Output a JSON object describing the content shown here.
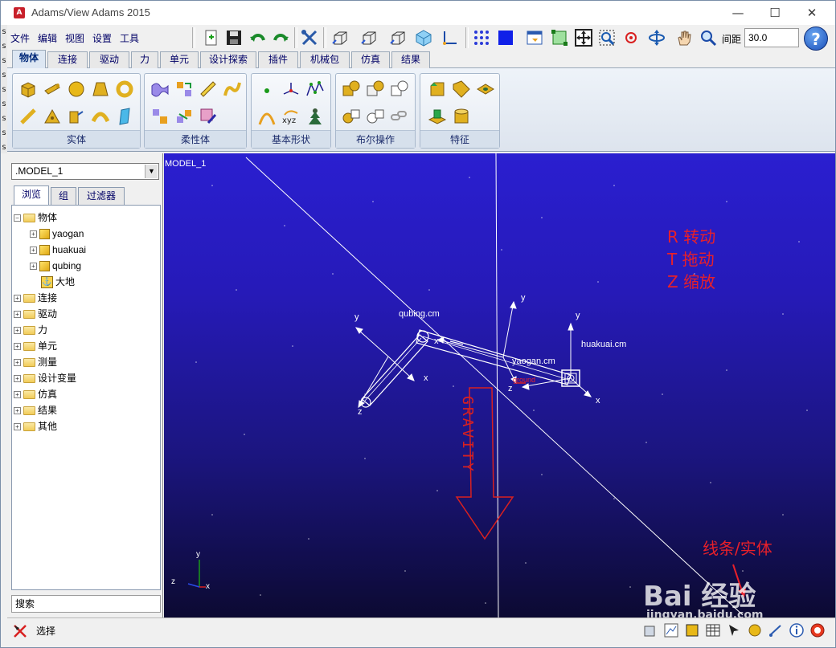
{
  "window": {
    "title": "Adams/View Adams 2015",
    "app_icon_letter": "A",
    "minimize": "—",
    "maximize": "☐",
    "close": "✕"
  },
  "left_edge_letters": [
    "s",
    "s",
    "s",
    "s",
    "s",
    "s",
    "s",
    "s",
    "s"
  ],
  "menu": [
    "文件",
    "编辑",
    "视图",
    "设置",
    "工具"
  ],
  "toolbar": {
    "distance_label": "间距",
    "distance_value": "30.0",
    "help": "?"
  },
  "ribbon_tabs": [
    "物体",
    "连接",
    "驱动",
    "力",
    "单元",
    "设计探索",
    "插件",
    "机械包",
    "仿真",
    "结果"
  ],
  "ribbon_groups": [
    "实体",
    "柔性体",
    "基本形状",
    "布尔操作",
    "特征"
  ],
  "left_panel": {
    "model_select": ".MODEL_1",
    "tabs": [
      "浏览",
      "组",
      "过滤器"
    ],
    "tree": {
      "root": "物体",
      "bodies": [
        "yaogan",
        "huakuai",
        "qubing"
      ],
      "ground": "大地",
      "folders": [
        "连接",
        "驱动",
        "力",
        "单元",
        "测量",
        "设计变量",
        "仿真",
        "结果",
        "其他"
      ]
    },
    "search_placeholder": "搜索"
  },
  "viewport": {
    "model_label": "MODEL_1",
    "cm_labels": {
      "qubing": "qubing.cm",
      "yaogan": "yaogan.cm",
      "huakuai": "huakuai.cm",
      "red_marker": "ground"
    },
    "gravity_text": "GRAVITY",
    "axis": {
      "x": "x",
      "y": "y",
      "z": "z"
    },
    "annotations": {
      "rotate": "R 转动",
      "pan": "T 拖动",
      "zoom": "Z 缩放",
      "line_solid": "线条/实体"
    },
    "watermark_brand": "Bai 经验",
    "watermark_url": "jingyan.baidu.com"
  },
  "status": {
    "text": "选择"
  },
  "colors": {
    "accent": "#002a7a",
    "annotation": "#e8202a",
    "viewport_top": "#2a1fd0",
    "viewport_bottom": "#0c0a32"
  }
}
